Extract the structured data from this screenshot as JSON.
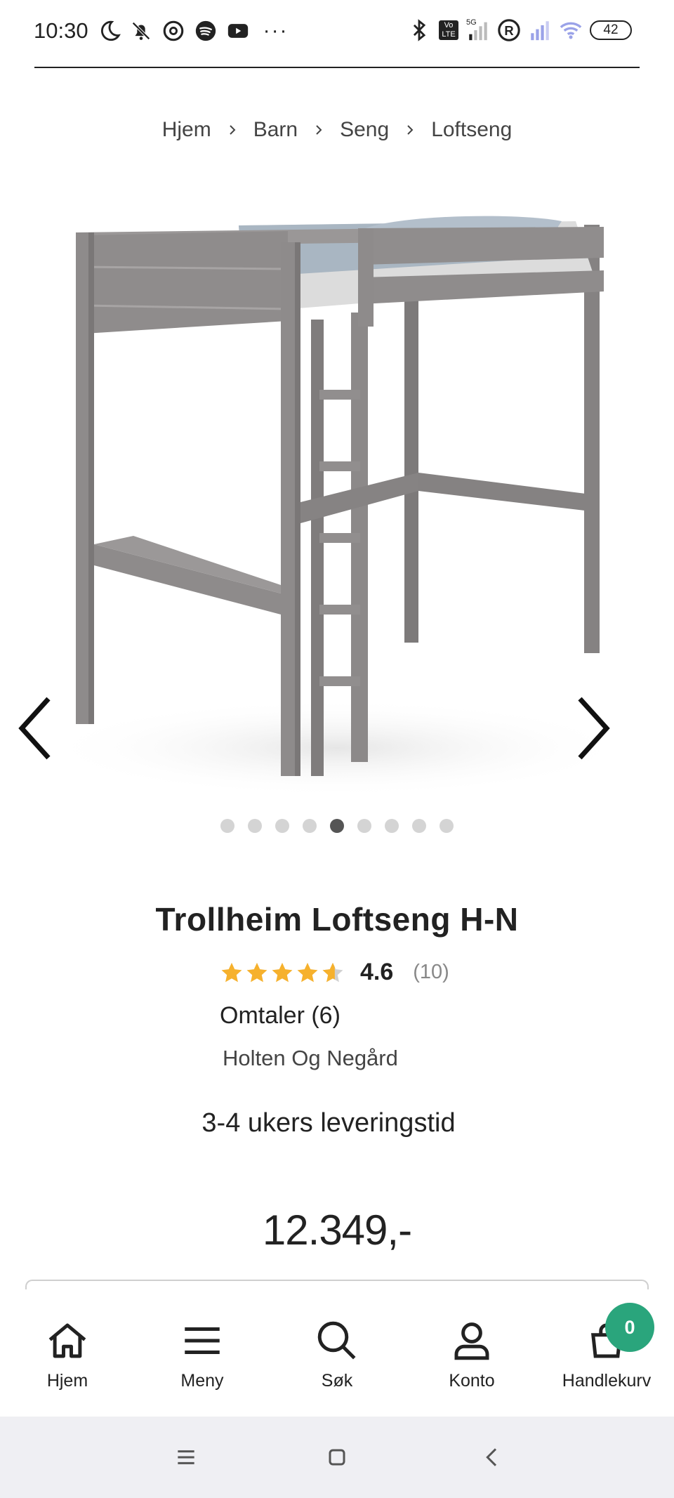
{
  "status_bar": {
    "time": "10:30",
    "battery": "42",
    "icons_left": [
      "moon-icon",
      "bell-off-icon",
      "threads-icon",
      "spotify-icon",
      "youtube-icon",
      "more-dots-icon"
    ],
    "icons_right": [
      "bluetooth-icon",
      "volte-icon",
      "signal-5g-icon",
      "registered-icon",
      "signal-icon",
      "wifi-icon"
    ],
    "network_label": "5G",
    "volte_label": "Vo LTE",
    "more_label": "···",
    "registered_label": "R"
  },
  "breadcrumb": [
    "Hjem",
    "Barn",
    "Seng",
    "Loftseng"
  ],
  "gallery": {
    "image_count": 9,
    "active_index": 4,
    "icon_prev": "chevron-left-icon",
    "icon_next": "chevron-right-icon"
  },
  "product": {
    "title": "Trollheim Loftseng H-N",
    "rating": "4.6",
    "rating_fraction": 0.92,
    "rating_count": "(10)",
    "reviews": "Omtaler (6)",
    "brand": "Holten Og Negård",
    "delivery": "3-4 ukers leveringstid",
    "price": "12.349,-"
  },
  "bottom_nav": {
    "items": [
      {
        "label": "Hjem",
        "icon": "home-icon"
      },
      {
        "label": "Meny",
        "icon": "menu-icon"
      },
      {
        "label": "Søk",
        "icon": "search-icon"
      },
      {
        "label": "Konto",
        "icon": "user-icon"
      },
      {
        "label": "Handlekurv",
        "icon": "cart-icon"
      }
    ],
    "cart_count": "0"
  },
  "colors": {
    "star": "#f6b12d",
    "star_empty": "#d0d0d0",
    "badge": "#2aa57c",
    "bed_frame": "#8a8787",
    "system_nav_bg": "#efeff3"
  }
}
